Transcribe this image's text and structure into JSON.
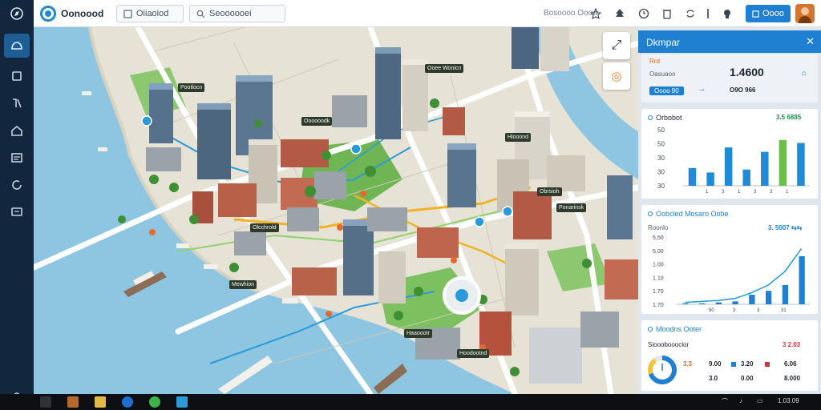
{
  "app": {
    "title": "Oonoood"
  },
  "tabs": [
    {
      "label": "Oiiaoiod"
    },
    {
      "label": "Seoooooei"
    }
  ],
  "topbar": {
    "label": "Bosoooo Ooow",
    "button_label": "Oooo"
  },
  "icons": {
    "rail": [
      "map-icon",
      "layers-icon",
      "route-icon",
      "home-icon",
      "list-icon",
      "refresh-icon",
      "message-icon",
      "user-icon"
    ],
    "toolbar": [
      "pin-icon",
      "tree-icon",
      "clock-icon",
      "trash-icon",
      "sync-icon",
      "bell-icon",
      "shield-icon"
    ]
  },
  "map": {
    "labels": [
      "Pootlocn",
      "Oooooodk",
      "Ooee Wonicn",
      "Hlooond",
      "Olcchrold",
      "Ponarinsk",
      "Mewhion",
      "Haaoootr",
      "Hoodootnd",
      "Obrsioh"
    ],
    "controls": [
      "⤢",
      "◎"
    ]
  },
  "panel": {
    "title": "Dkmpar",
    "close": "✕",
    "summary": {
      "label": "Rrd",
      "caption": "Oasuaoo",
      "value": "1.4600",
      "sub_value": "O9O 966",
      "pill": "Oooo 90"
    },
    "chart1": {
      "title": "Orbobot",
      "metric": "3.5 6885"
    },
    "chart2": {
      "title": "Oobcled Mosaro Oobe",
      "metric": "3. 5007 ⇆⇆",
      "sub": "Roonlo"
    },
    "card3": {
      "title": "Moodns Ooter",
      "subtitle": "Sioooboooclor",
      "metric": "3 2.03",
      "rows": [
        [
          "3.3",
          "9.00",
          "3.20",
          "6.06"
        ],
        [
          "3.0",
          "0.00",
          "8.000"
        ]
      ]
    }
  },
  "taskbar": {
    "clock": "1.03.09"
  },
  "colors": {
    "accent": "#1f7fd1",
    "rail": "#12263d",
    "water": "#8ec6e2",
    "green_bar": "#6cbf4a"
  },
  "chart_data": [
    {
      "type": "bar",
      "title": "Orbobot",
      "yticks": [
        "50",
        "50",
        "30",
        "30",
        "30"
      ],
      "xticks": [
        "1",
        "3",
        "1",
        "3",
        "3",
        "1"
      ],
      "values": [
        12,
        9,
        26,
        11,
        23,
        31,
        29
      ],
      "bar_colors": [
        "#1f8ad6",
        "#1f8ad6",
        "#1f8ad6",
        "#1f8ad6",
        "#1f8ad6",
        "#6cbf4a",
        "#1f8ad6"
      ],
      "ylim": [
        0,
        38
      ]
    },
    {
      "type": "bar",
      "title": "Oobcled Mosaro Oobe",
      "yticks": [
        "5,50",
        "5.00",
        "1.00",
        "1.10",
        "1.70",
        "1.70"
      ],
      "xticks": [
        "50",
        "3",
        "3",
        "31"
      ],
      "values": [
        1,
        1,
        2,
        3,
        10,
        14,
        20,
        50
      ],
      "trend": [
        2,
        3,
        4,
        6,
        12,
        20,
        34,
        58
      ],
      "ylim": [
        0,
        70
      ]
    },
    {
      "type": "pie",
      "title": "Moodns Ooter",
      "values": [
        70,
        20,
        10
      ],
      "colors": [
        "#1f7fd1",
        "#f2c53d",
        "#dfe6ee"
      ]
    }
  ]
}
